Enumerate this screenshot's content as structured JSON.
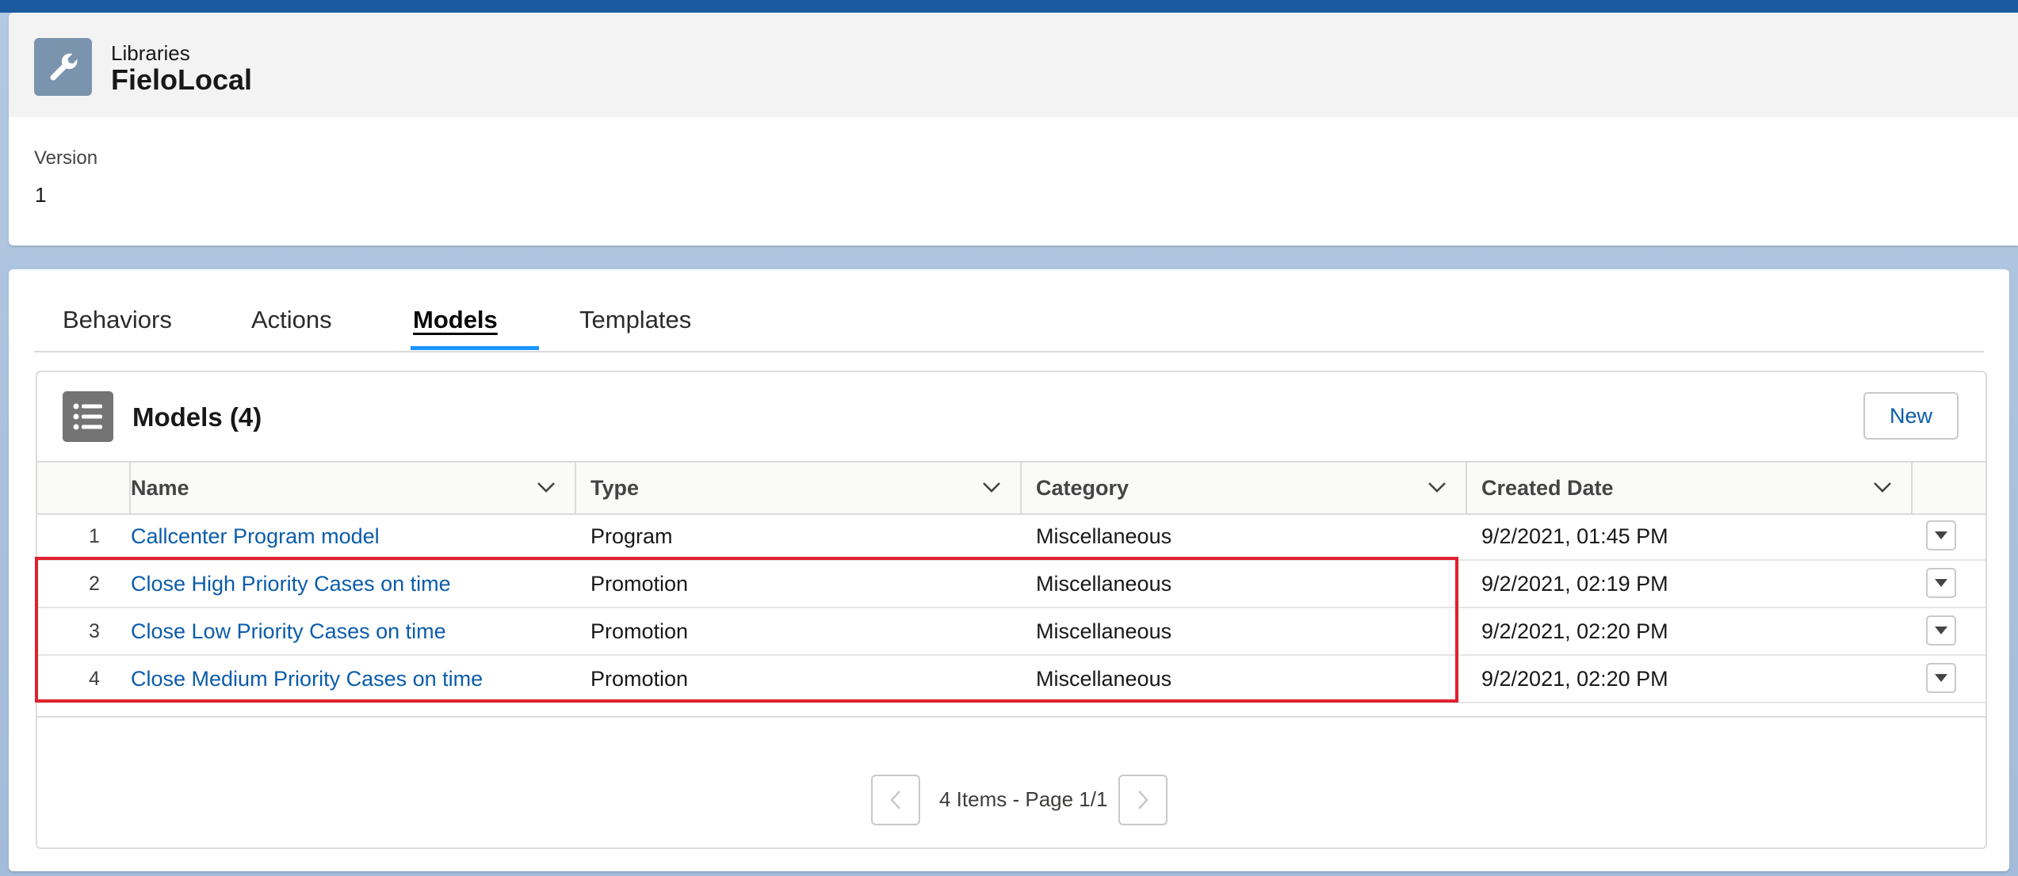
{
  "header": {
    "object_label": "Libraries",
    "record_title": "FieloLocal",
    "fields": [
      {
        "label": "Version",
        "value": "1"
      }
    ]
  },
  "tabs": [
    {
      "label": "Behaviors",
      "active": false
    },
    {
      "label": "Actions",
      "active": false
    },
    {
      "label": "Models",
      "active": true
    },
    {
      "label": "Templates",
      "active": false
    }
  ],
  "related_list": {
    "title": "Models (4)",
    "new_label": "New",
    "columns": [
      "Name",
      "Type",
      "Category",
      "Created Date"
    ],
    "rows": [
      {
        "num": "1",
        "name": "Callcenter Program model",
        "type": "Program",
        "category": "Miscellaneous",
        "created": "9/2/2021, 01:45 PM"
      },
      {
        "num": "2",
        "name": "Close High Priority Cases on time",
        "type": "Promotion",
        "category": "Miscellaneous",
        "created": "9/2/2021, 02:19 PM"
      },
      {
        "num": "3",
        "name": "Close Low Priority Cases on time",
        "type": "Promotion",
        "category": "Miscellaneous",
        "created": "9/2/2021, 02:20 PM"
      },
      {
        "num": "4",
        "name": "Close Medium Priority Cases on time",
        "type": "Promotion",
        "category": "Miscellaneous",
        "created": "9/2/2021, 02:20 PM"
      }
    ],
    "pager_text": "4 Items - Page 1/1"
  },
  "colors": {
    "brand_blue": "#0b5cab",
    "tab_indicator": "#1b96ff",
    "highlight_red": "#e0212d"
  }
}
